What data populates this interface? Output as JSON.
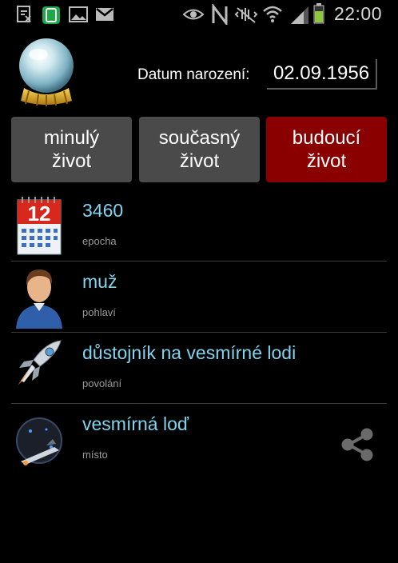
{
  "status_bar": {
    "time": "22:00"
  },
  "header": {
    "dob_label": "Datum narození:",
    "dob_value": "02.09.1956"
  },
  "buttons": {
    "past": [
      "minulý",
      "život"
    ],
    "present": [
      "současný",
      "život"
    ],
    "future": [
      "budoucí",
      "život"
    ]
  },
  "items": [
    {
      "title": "3460",
      "subtitle": "epocha",
      "icon": "calendar-icon"
    },
    {
      "title": "muž",
      "subtitle": "pohlaví",
      "icon": "man-avatar-icon"
    },
    {
      "title": "důstojník na vesmírné lodi",
      "subtitle": "povolání",
      "icon": "rocket-icon"
    },
    {
      "title": "vesmírná loď",
      "subtitle": "místo",
      "icon": "spaceship-icon"
    }
  ],
  "calendar_day": "12",
  "colors": {
    "accent_text": "#7fd4ee",
    "button_gray": "#4a4a4a",
    "button_active": "#8a0000"
  }
}
